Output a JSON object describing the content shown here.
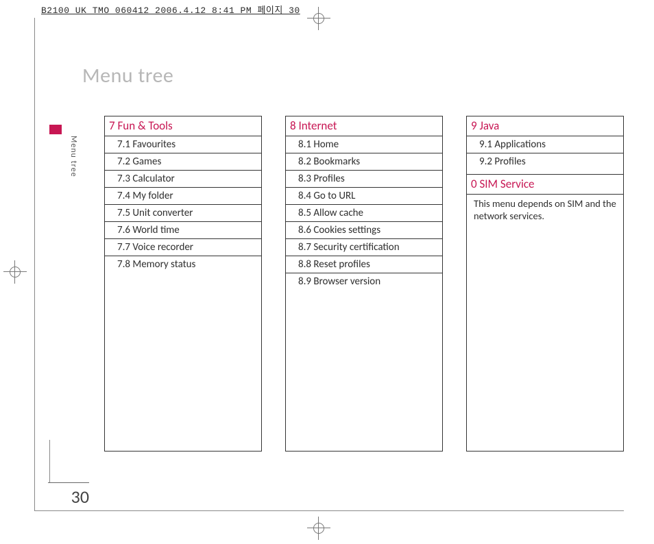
{
  "docinfo": "B2100 UK TMO 060412  2006.4.12 8:41 PM  페이지 30",
  "page_title": "Menu tree",
  "side_caption": "Menu tree",
  "page_number": "30",
  "columns": [
    {
      "header": "7 Fun & Tools",
      "items": [
        "7.1 Favourites",
        "7.2 Games",
        "7.3 Calculator",
        "7.4 My folder",
        "7.5 Unit converter",
        "7.6 World time",
        "7.7 Voice recorder",
        "7.8 Memory status"
      ]
    },
    {
      "header": "8 Internet",
      "items": [
        "8.1 Home",
        "8.2 Bookmarks",
        "8.3 Profiles",
        "8.4 Go to URL",
        "8.5 Allow cache",
        "8.6 Cookies settings",
        "8.7 Security certification",
        "8.8 Reset profiles",
        "8.9 Browser version"
      ]
    }
  ],
  "column3": {
    "header_a": "9 Java",
    "items_a": [
      "9.1 Applications",
      "9.2 Profiles"
    ],
    "header_b": "0 SIM Service",
    "note": "This menu depends on SIM and the network services."
  }
}
